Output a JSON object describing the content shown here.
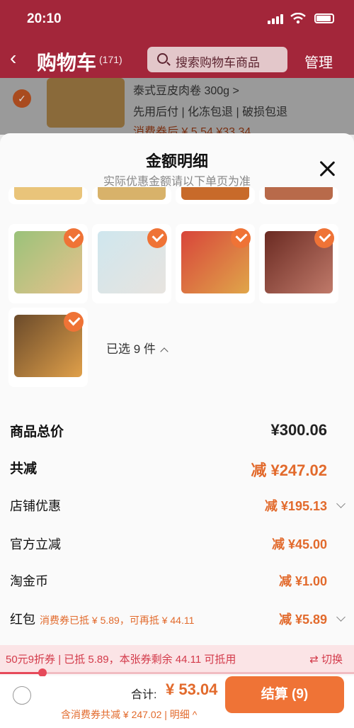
{
  "status": {
    "time": "20:10"
  },
  "header": {
    "back_icon": "chevron-left-icon",
    "title": "购物车",
    "count": "(171)",
    "search_placeholder": "搜索购物车商品",
    "manage": "管理"
  },
  "bg_item": {
    "line1": "泰式豆皮肉卷 300g >",
    "line2": "先用后付 | 化冻包退 | 破损包退",
    "line3": "消费券后 ¥ 5.54 ¥33.34"
  },
  "sheet": {
    "title": "金额明细",
    "subtitle": "实际优惠金额请以下单页为准",
    "selected": "已选 9 件",
    "rows": {
      "total": {
        "label": "商品总价",
        "value": "¥300.06"
      },
      "discount": {
        "label": "共减",
        "value": "减 ¥247.02"
      },
      "shop": {
        "label": "店铺优惠",
        "value": "减 ¥195.13"
      },
      "official": {
        "label": "官方立减",
        "value": "减 ¥45.00"
      },
      "coin": {
        "label": "淘金币",
        "value": "减 ¥1.00"
      },
      "redpack": {
        "label": "红包",
        "note": "消费券已抵 ¥ 5.89，可再抵 ¥ 44.11",
        "value": "减 ¥5.89"
      }
    },
    "coupon_bar": {
      "text": "50元9折券 | 已抵 5.89，本张券剩余 44.11 可抵用",
      "switch": "⇄ 切换",
      "progress": 0.12
    },
    "footer": {
      "total_label": "合计:",
      "total_value": "¥ 53.04",
      "subline": "含消费券共减 ¥ 247.02 | 明细 ^",
      "checkout": "结算 (9)"
    }
  },
  "colors": {
    "accent": "#ef7336",
    "price": "#e26a2c",
    "header_bg": "#a3263a",
    "coupon_bg": "#fbe4e6"
  }
}
